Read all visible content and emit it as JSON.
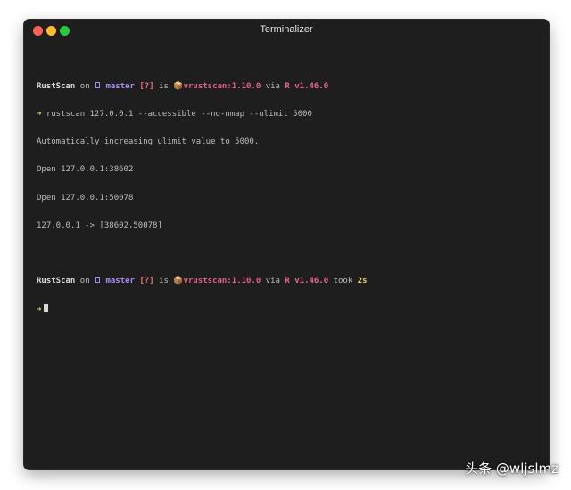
{
  "window": {
    "title": "Terminalizer",
    "controls": [
      "close",
      "minimize",
      "maximize"
    ],
    "colors": {
      "close": "#fe5f57",
      "minimize": "#febc2e",
      "maximize": "#28c840",
      "background": "#1e1e1e"
    }
  },
  "terminal": {
    "prompt1": {
      "dir": "RustScan",
      "on": "on",
      "git_icon": "git-branch-icon",
      "branch": "master",
      "status": "[?]",
      "is": "is",
      "pkg_icon": "📦",
      "pkg": "vrustscan:1.10.0",
      "via": "via",
      "rust_icon": "R",
      "rust_version": "v1.46.0"
    },
    "command": {
      "arrow": "➜",
      "text": "rustscan 127.0.0.1 --accessible --no-nmap --ulimit 5000"
    },
    "output": [
      "Automatically increasing ulimit value to 5000.",
      "Open 127.0.0.1:38602",
      "Open 127.0.0.1:50078",
      "127.0.0.1 -> [38602,50078]"
    ],
    "prompt2": {
      "dir": "RustScan",
      "on": "on",
      "git_icon": "git-branch-icon",
      "branch": "master",
      "status": "[?]",
      "is": "is",
      "pkg_icon": "📦",
      "pkg": "vrustscan:1.10.0",
      "via": "via",
      "rust_icon": "R",
      "rust_version": "v1.46.0",
      "took": "took",
      "duration": "2s"
    },
    "input": {
      "arrow": "➜",
      "text": ""
    }
  },
  "watermark": "头条 @wljslmz"
}
